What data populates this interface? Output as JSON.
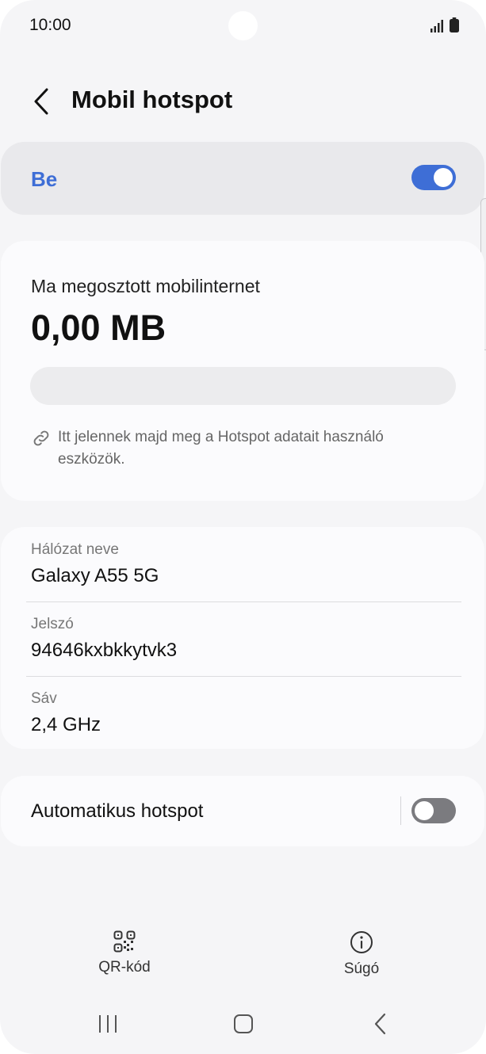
{
  "status_bar": {
    "time": "10:00",
    "icons": [
      "signal-icon",
      "battery-icon"
    ]
  },
  "header": {
    "back_icon": "chevron-left-icon",
    "title": "Mobil hotspot"
  },
  "master_switch": {
    "label": "Be",
    "on": true,
    "accent_color": "#3e6ed6"
  },
  "usage": {
    "label": "Ma megosztott mobilinternet",
    "value": "0,00 MB",
    "used_fraction": 0,
    "devices_icon": "link-icon",
    "devices_text": "Itt jelennek majd meg a Hotspot adatait használó eszközök."
  },
  "network": {
    "name_label": "Hálózat neve",
    "name_value": "Galaxy A55 5G",
    "password_label": "Jelszó",
    "password_value": "94646kxbkkytvk3",
    "band_label": "Sáv",
    "band_value": "2,4 GHz"
  },
  "auto_hotspot": {
    "label": "Automatikus hotspot",
    "on": false
  },
  "actions": [
    {
      "icon": "qr-code-icon",
      "label": "QR-kód"
    },
    {
      "icon": "info-icon",
      "label": "Súgó"
    }
  ],
  "nav_bar": [
    "recents-icon",
    "home-icon",
    "back-icon"
  ]
}
